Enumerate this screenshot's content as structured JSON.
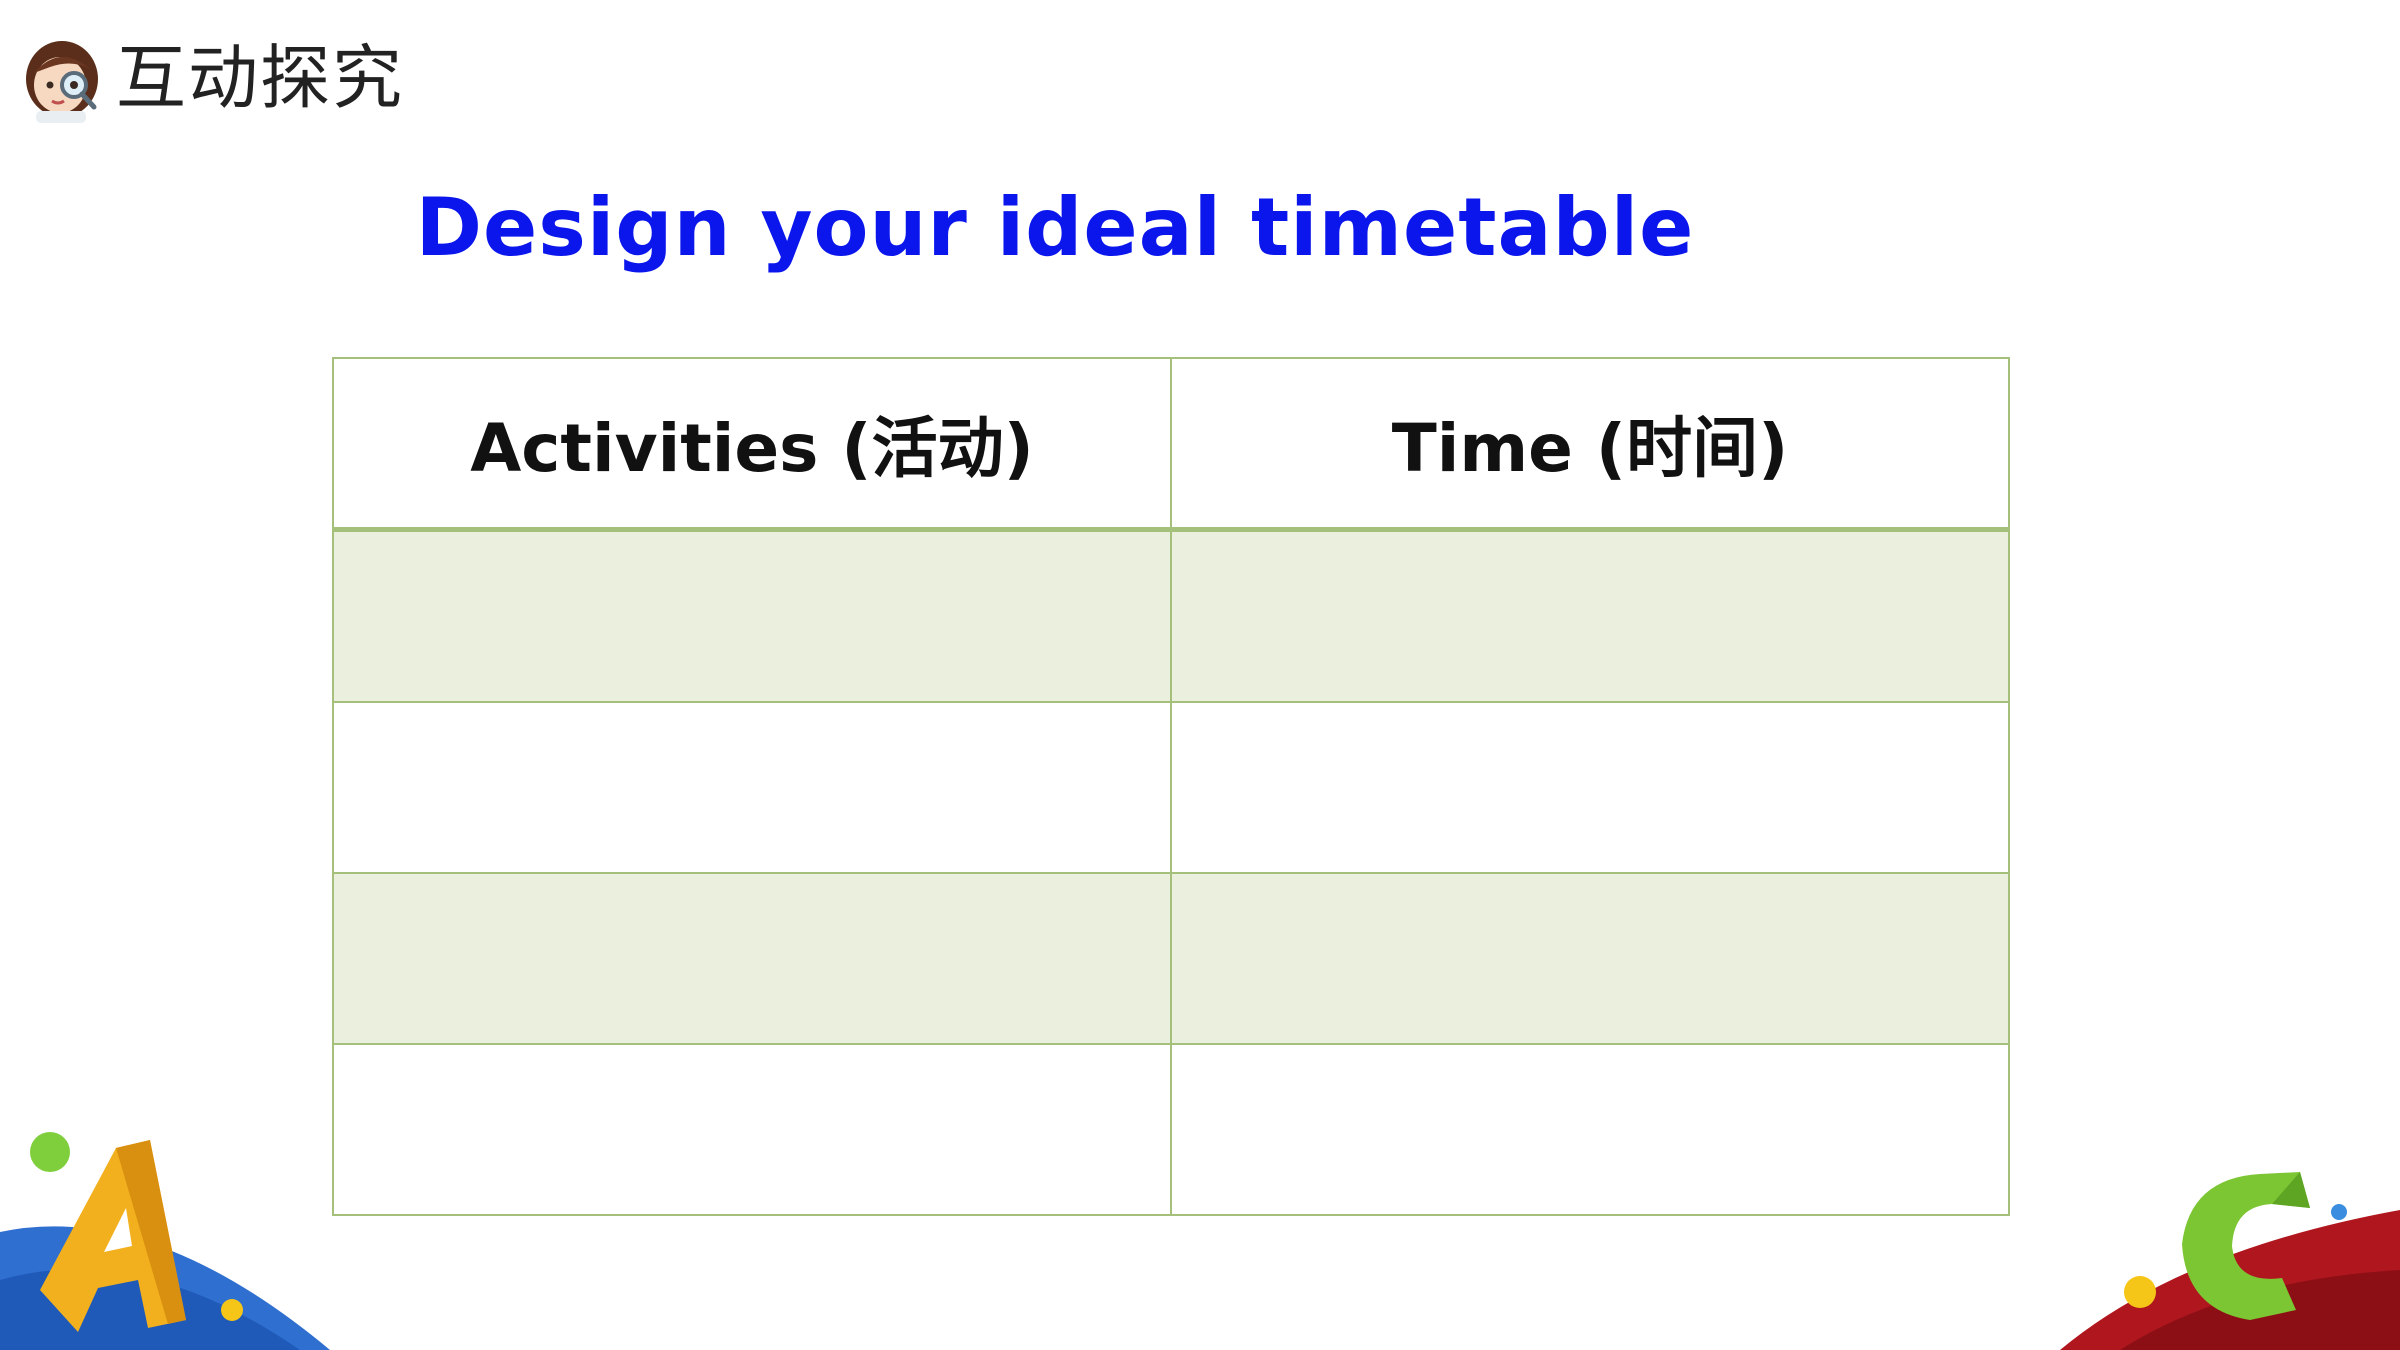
{
  "header": {
    "section_title": "互动探究",
    "avatar_icon": "girl-with-magnifier-icon"
  },
  "slide": {
    "title": "Design your ideal timetable"
  },
  "timetable": {
    "columns": [
      "Activities (活动)",
      "Time (时间)"
    ],
    "rows": [
      [
        "",
        ""
      ],
      [
        "",
        ""
      ],
      [
        "",
        ""
      ],
      [
        "",
        ""
      ]
    ]
  },
  "colors": {
    "title_blue": "#0a16ec",
    "table_border": "#a4c07a",
    "row_shade": "#eaefde"
  },
  "decorations": {
    "left": "letter-a-decoration",
    "right": "letter-c-decoration"
  }
}
